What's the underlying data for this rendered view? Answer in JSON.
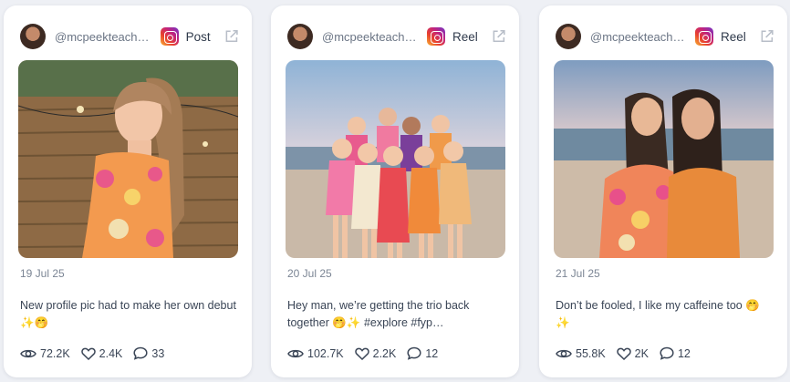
{
  "posts": [
    {
      "handle": "@mcpeekteach…",
      "platform_icon": "instagram-icon",
      "type": "Post",
      "date": "19 Jul 25",
      "caption": "New profile pic had to make her own debut ✨🤭",
      "views": "72.2K",
      "likes": "2.4K",
      "comments": "33"
    },
    {
      "handle": "@mcpeekteach…",
      "platform_icon": "instagram-icon",
      "type": "Reel",
      "date": "20 Jul 25",
      "caption": "Hey man, we’re getting the trio back together 🤭✨ #explore #fyp…",
      "views": "102.7K",
      "likes": "2.2K",
      "comments": "12"
    },
    {
      "handle": "@mcpeekteach…",
      "platform_icon": "instagram-icon",
      "type": "Reel",
      "date": "21 Jul 25",
      "caption": "Don’t be fooled, I like my caffeine too 🤭✨",
      "views": "55.8K",
      "likes": "2K",
      "comments": "12"
    }
  ],
  "colors": {
    "page_background": "#eef0f5",
    "card_background": "#ffffff",
    "muted_text": "#7b8594"
  }
}
